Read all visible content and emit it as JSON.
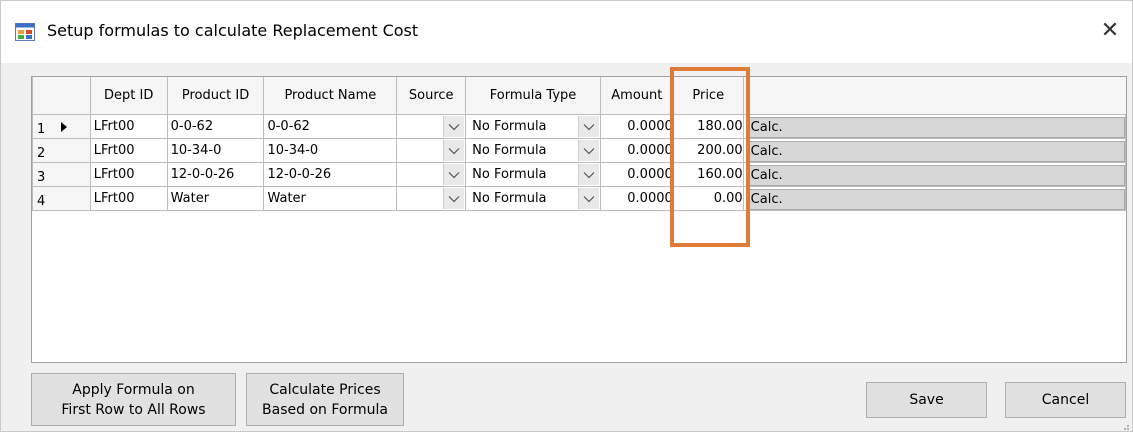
{
  "window": {
    "title": "Setup formulas to calculate Replacement Cost",
    "close_glyph": "✕",
    "icon": "app-window-icon"
  },
  "grid": {
    "columns": [
      "Dept ID",
      "Product ID",
      "Product Name",
      "Source",
      "Formula Type",
      "Amount",
      "Price"
    ],
    "rows": [
      {
        "num": "1",
        "dept": "LFrt00",
        "product_id": "0-0-62",
        "product_name": "0-0-62",
        "source": "",
        "formula_type": "No Formula",
        "amount": "0.0000",
        "price": "180.00",
        "calc": "Calc.",
        "current": true
      },
      {
        "num": "2",
        "dept": "LFrt00",
        "product_id": "10-34-0",
        "product_name": "10-34-0",
        "source": "",
        "formula_type": "No Formula",
        "amount": "0.0000",
        "price": "200.00",
        "calc": "Calc.",
        "current": false
      },
      {
        "num": "3",
        "dept": "LFrt00",
        "product_id": "12-0-0-26",
        "product_name": "12-0-0-26",
        "source": "",
        "formula_type": "No Formula",
        "amount": "0.0000",
        "price": "160.00",
        "calc": "Calc.",
        "current": false
      },
      {
        "num": "4",
        "dept": "LFrt00",
        "product_id": "Water",
        "product_name": "Water",
        "source": "",
        "formula_type": "No Formula",
        "amount": "0.0000",
        "price": "0.00",
        "calc": "Calc.",
        "current": false
      }
    ],
    "highlight_color": "#e07b3a"
  },
  "buttons": {
    "apply_line1": "Apply Formula on",
    "apply_line2": "First Row to All Rows",
    "calculate_line1": "Calculate Prices",
    "calculate_line2": "Based on Formula",
    "save": "Save",
    "cancel": "Cancel"
  }
}
